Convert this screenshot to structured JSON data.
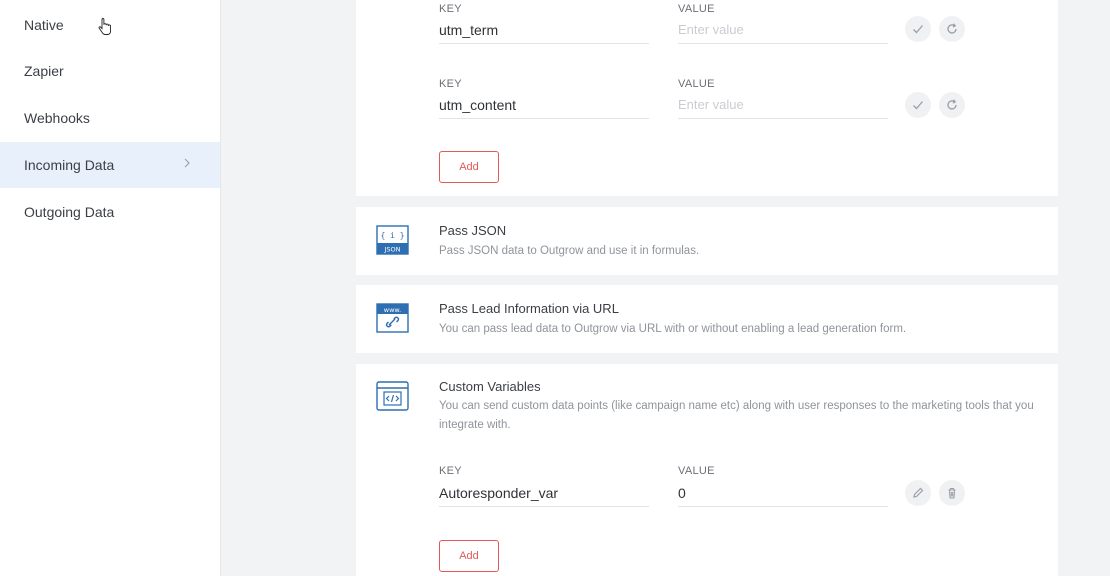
{
  "sidebar": {
    "items": [
      {
        "label": "Native"
      },
      {
        "label": "Zapier"
      },
      {
        "label": "Webhooks"
      },
      {
        "label": "Incoming Data"
      },
      {
        "label": "Outgoing Data"
      }
    ],
    "active_index": 3
  },
  "utm_params": {
    "key_header": "KEY",
    "value_header": "VALUE",
    "rows": [
      {
        "key": "utm_term",
        "value_placeholder": "Enter value"
      },
      {
        "key": "utm_content",
        "value_placeholder": "Enter value"
      }
    ],
    "add_label": "Add"
  },
  "pass_json": {
    "title": "Pass JSON",
    "description": "Pass JSON data to Outgrow and use it in formulas.",
    "icon_text": "JSON"
  },
  "pass_lead": {
    "title": "Pass Lead Information via URL",
    "description": "You can pass lead data to Outgrow via URL with or without enabling a lead generation form.",
    "icon_text": "www."
  },
  "custom_vars": {
    "title": "Custom Variables",
    "description": "You can send custom data points (like campaign name etc) along with user responses to the marketing tools that you integrate with.",
    "key_header": "KEY",
    "value_header": "VALUE",
    "rows": [
      {
        "key": "Autoresponder_var",
        "value": "0"
      }
    ],
    "add_label": "Add"
  },
  "colors": {
    "accent": "#e2595a",
    "icon_blue": "#2d6fb0",
    "active_bg": "#e8f1fb"
  }
}
